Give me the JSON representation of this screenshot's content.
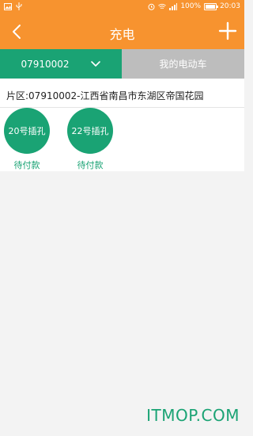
{
  "status_bar": {
    "battery": "100%",
    "time": "20:03"
  },
  "header": {
    "title": "充电"
  },
  "tabs": {
    "station_value": "07910002",
    "vehicle_label": "我的电动车"
  },
  "content": {
    "area_text": "片区:07910002-江西省南昌市东湖区帝国花园",
    "sockets": [
      {
        "label": "20号插孔",
        "status": "待付款"
      },
      {
        "label": "22号插孔",
        "status": "待付款"
      }
    ]
  },
  "watermark": "ITMOP.COM",
  "colors": {
    "header_orange": "#f7932f",
    "accent_green": "#1aa374",
    "tab_inactive": "#bdbdbd"
  }
}
